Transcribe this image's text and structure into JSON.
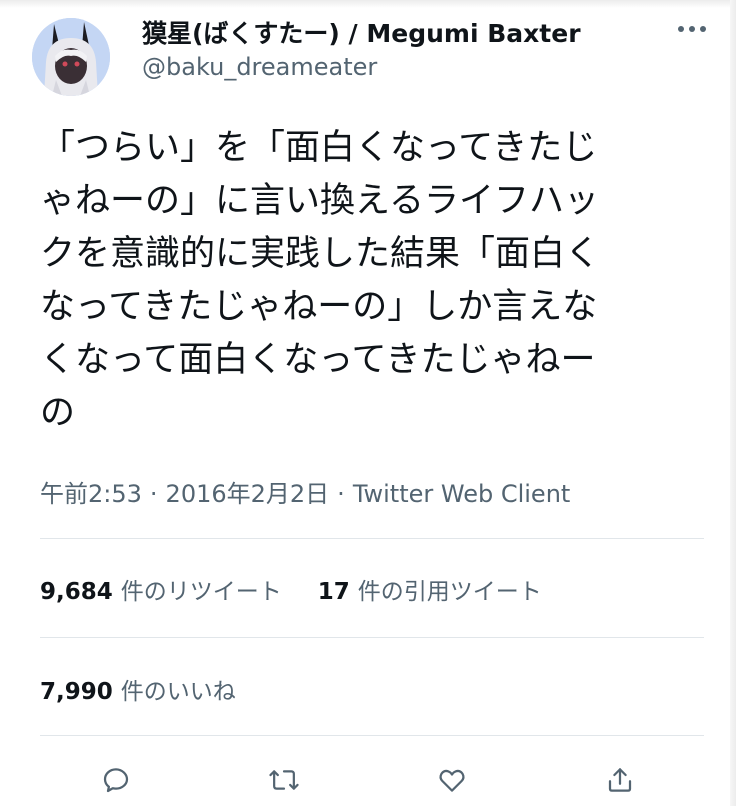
{
  "tweet": {
    "author": {
      "display_name": "獏星(ばくすたー) / Megumi Baxter",
      "handle": "@baku_dreameater",
      "avatar_icon": "avatar-bunny-character"
    },
    "text_lines": [
      "「つらい」を「面白くなってきたじ",
      "ゃねーの」に言い換えるライフハッ",
      "クを意識的に実践した結果「面白く",
      "なってきたじゃねーの」しか言えな",
      "くなって面白くなってきたじゃねー",
      "の"
    ],
    "meta": {
      "time": "午前2:53",
      "date": "2016年2月2日",
      "separator": "·",
      "source": "Twitter Web Client"
    },
    "stats": {
      "retweets_count": "9,684",
      "retweets_label": "件のリツイート",
      "quotes_count": "17",
      "quotes_label": "件の引用ツイート",
      "likes_count": "7,990",
      "likes_label": "件のいいね"
    },
    "actions": [
      "reply-icon",
      "retweet-icon",
      "like-icon",
      "share-icon"
    ]
  },
  "colors": {
    "text_primary": "#0f1419",
    "text_secondary": "#536471",
    "divider": "#e1e6ea"
  }
}
